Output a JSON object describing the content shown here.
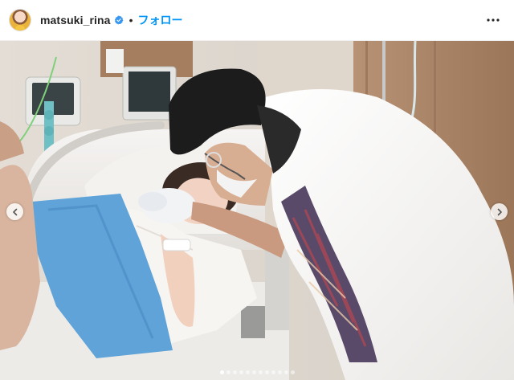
{
  "post": {
    "username": "matsuki_rina",
    "verified": true,
    "separator": "•",
    "follow_label": "フォロー",
    "accent_color": "#0095f6",
    "verified_color": "#3897f0"
  },
  "icons": {
    "more": "more-horizontal-icon",
    "prev": "chevron-left-icon",
    "next": "chevron-right-icon",
    "verified": "verified-badge-icon"
  },
  "carousel": {
    "total_slides": 12,
    "active_slide": 1
  }
}
